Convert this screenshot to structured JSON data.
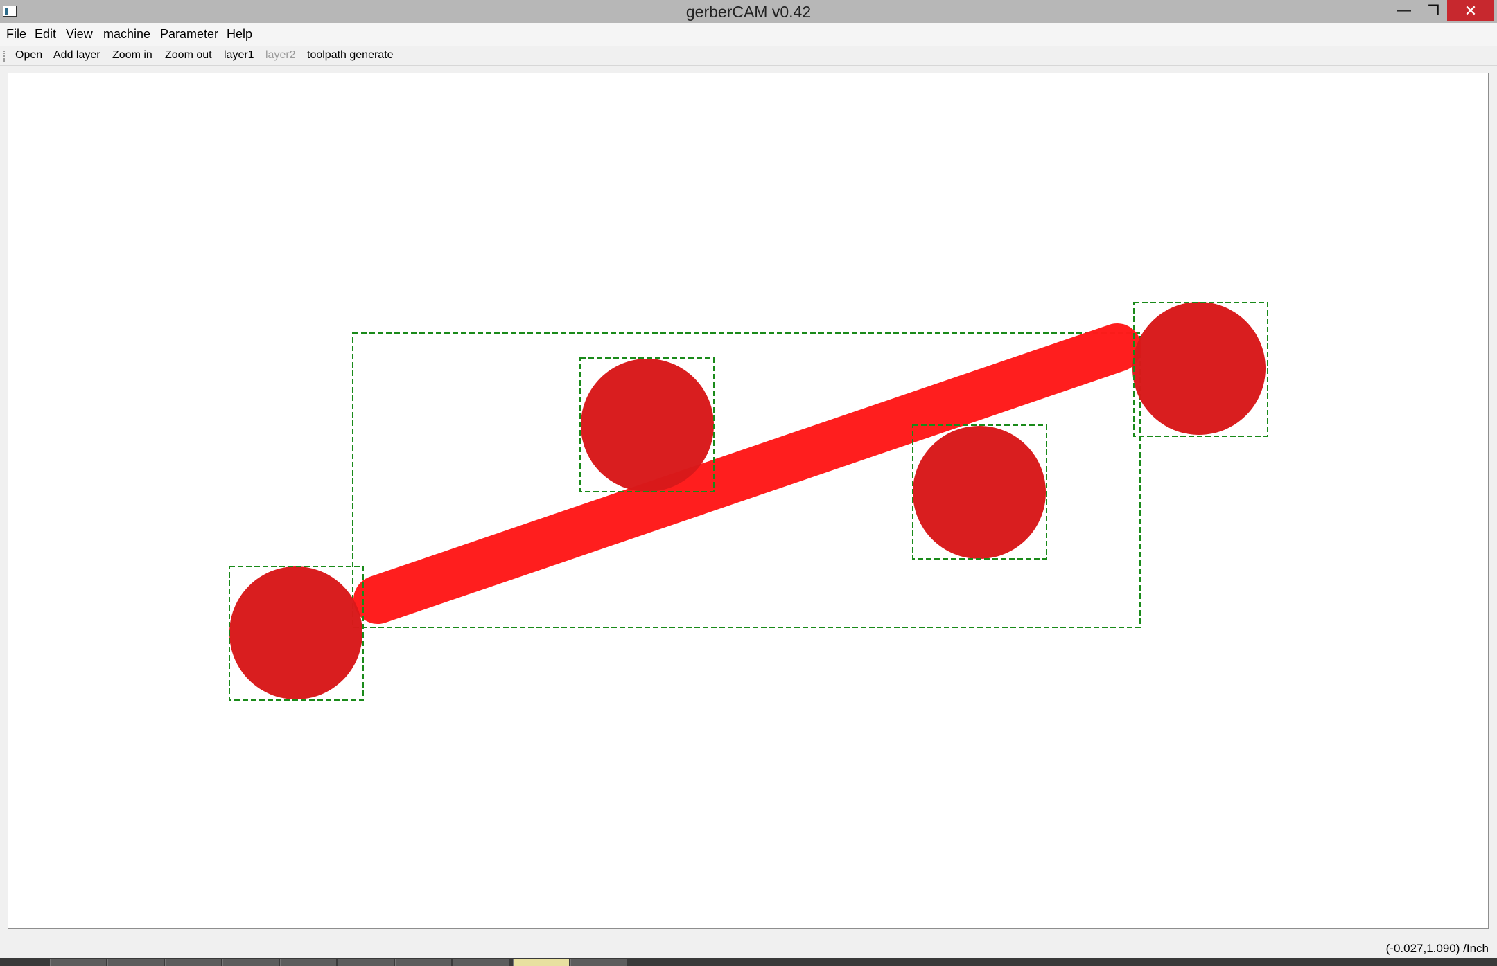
{
  "window": {
    "title": "gerberCAM v0.42",
    "minimize_symbol": "—",
    "maximize_symbol": "❐",
    "close_symbol": "✕"
  },
  "menu": [
    "File",
    "Edit",
    "View",
    "machine",
    "Parameter",
    "Help"
  ],
  "toolbar": {
    "open": "Open",
    "add_layer": "Add layer",
    "zoom_in": "Zoom in",
    "zoom_out": "Zoom out",
    "layer1": "layer1",
    "layer2": "layer2",
    "toolpath_generate": "toolpath generate"
  },
  "status": {
    "coordinates": "(-0.027,1.090) /Inch"
  },
  "colors": {
    "pad_fill": "#d8191b",
    "trace_fill": "#ff1a1a",
    "bounding_box": "#1a8a1a",
    "canvas_bg": "#ffffff",
    "close_button": "#c7282e"
  },
  "icons": {
    "app": "app-icon",
    "minimize": "minimize-icon",
    "maximize": "maximize-icon",
    "close": "close-icon"
  }
}
